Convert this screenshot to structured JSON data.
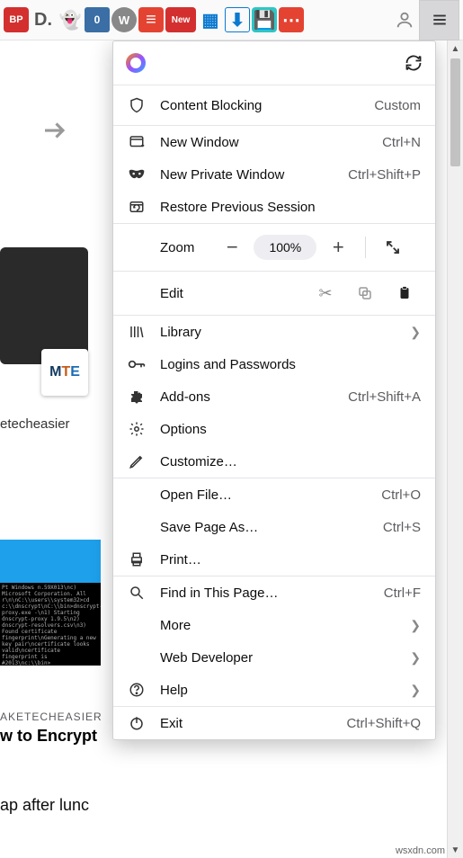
{
  "toolbar": {
    "icons": [
      "BP",
      "D.",
      "ghost",
      "0",
      "W",
      "todo",
      "New",
      "dash",
      "dl",
      "save",
      "dots",
      "user"
    ],
    "new_label": "New"
  },
  "background": {
    "mte": "MTE",
    "caption1": "etecheasier",
    "caption2a": "AKETECHEASIER",
    "caption2b": "w to Encrypt",
    "bottom_text": "ap after lunc",
    "terminal": "Pt Windows n.59X013\\nc) Microsoft Corporation. All r\\n\\nC:\\\\users\\\\system32>cd c:\\\\dnscrypt\\nC:\\\\bin>dnscrypt-proxy.exe -\\n1) Starting dnscrypt-proxy 1.9.5\\n2) dnscrypt-resolvers.csv\\n3) Found certificate fingerprint\\nGenerating a new key pair\\ncertificate looks valid\\ncertificate fingerprint is #2013\\nc:\\\\bin>"
  },
  "menu": {
    "sync_icon": "sync-icon",
    "content_blocking": {
      "label": "Content Blocking",
      "status": "Custom"
    },
    "new_window": {
      "label": "New Window",
      "shortcut": "Ctrl+N"
    },
    "new_private": {
      "label": "New Private Window",
      "shortcut": "Ctrl+Shift+P"
    },
    "restore": {
      "label": "Restore Previous Session"
    },
    "zoom": {
      "header": "Zoom",
      "value": "100%"
    },
    "edit": {
      "header": "Edit"
    },
    "library": {
      "label": "Library"
    },
    "logins": {
      "label": "Logins and Passwords"
    },
    "addons": {
      "label": "Add-ons",
      "shortcut": "Ctrl+Shift+A"
    },
    "options": {
      "label": "Options"
    },
    "customize": {
      "label": "Customize…"
    },
    "open_file": {
      "label": "Open File…",
      "shortcut": "Ctrl+O"
    },
    "save_as": {
      "label": "Save Page As…",
      "shortcut": "Ctrl+S"
    },
    "print": {
      "label": "Print…"
    },
    "find": {
      "label": "Find in This Page…",
      "shortcut": "Ctrl+F"
    },
    "more": {
      "label": "More"
    },
    "web_dev": {
      "label": "Web Developer"
    },
    "help": {
      "label": "Help"
    },
    "exit": {
      "label": "Exit",
      "shortcut": "Ctrl+Shift+Q"
    }
  },
  "watermark": "wsxdn.com"
}
